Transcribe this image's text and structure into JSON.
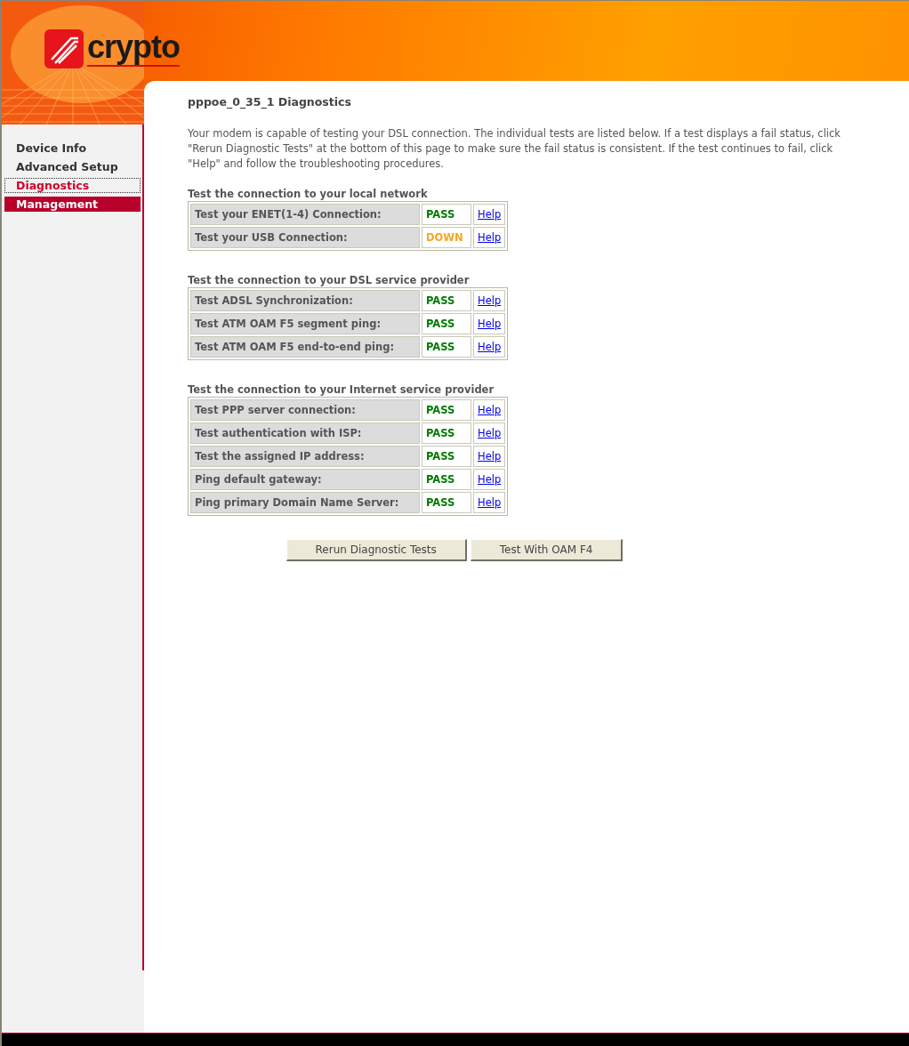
{
  "logo": {
    "text": "crypto"
  },
  "sidebar": {
    "items": [
      {
        "label": "Device Info",
        "selected": false,
        "highlighted": false
      },
      {
        "label": "Advanced Setup",
        "selected": false,
        "highlighted": false
      },
      {
        "label": "Diagnostics",
        "selected": true,
        "highlighted": false
      },
      {
        "label": "Management",
        "selected": false,
        "highlighted": true
      }
    ]
  },
  "title": "pppoe_0_35_1 Diagnostics",
  "intro": "Your modem is capable of testing your DSL connection. The individual tests are listed below. If a test displays a fail status, click \"Rerun Diagnostic Tests\" at the bottom of this page to make sure the fail status is consistent. If the test continues to fail, click \"Help\" and follow the troubleshooting procedures.",
  "sections": [
    {
      "heading": "Test the connection to your local network",
      "rows": [
        {
          "test": "Test your ENET(1-4) Connection:",
          "result": "PASS",
          "ok": true,
          "help": "Help"
        },
        {
          "test": "Test your USB Connection:",
          "result": "DOWN",
          "ok": false,
          "help": "Help"
        }
      ]
    },
    {
      "heading": "Test the connection to your DSL service provider",
      "rows": [
        {
          "test": "Test ADSL Synchronization:",
          "result": "PASS",
          "ok": true,
          "help": "Help"
        },
        {
          "test": "Test ATM OAM F5 segment ping:",
          "result": "PASS",
          "ok": true,
          "help": "Help"
        },
        {
          "test": "Test ATM OAM F5 end-to-end ping:",
          "result": "PASS",
          "ok": true,
          "help": "Help"
        }
      ]
    },
    {
      "heading": "Test the connection to your Internet service provider",
      "rows": [
        {
          "test": "Test PPP server connection:",
          "result": "PASS",
          "ok": true,
          "help": "Help"
        },
        {
          "test": "Test authentication with ISP:",
          "result": "PASS",
          "ok": true,
          "help": "Help"
        },
        {
          "test": "Test the assigned IP address:",
          "result": "PASS",
          "ok": true,
          "help": "Help"
        },
        {
          "test": "Ping default gateway:",
          "result": "PASS",
          "ok": true,
          "help": "Help"
        },
        {
          "test": "Ping primary Domain Name Server:",
          "result": "PASS",
          "ok": true,
          "help": "Help"
        }
      ]
    }
  ],
  "buttons": [
    "Rerun Diagnostic Tests",
    "Test With OAM F4"
  ]
}
